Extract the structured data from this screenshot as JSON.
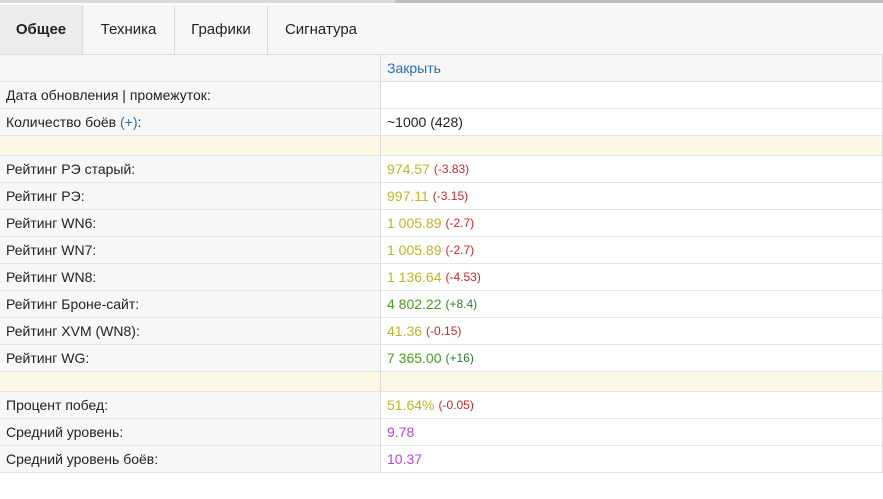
{
  "tabs": [
    {
      "label": "Общее",
      "active": true
    },
    {
      "label": "Техника",
      "active": false
    },
    {
      "label": "Графики",
      "active": false
    },
    {
      "label": "Сигнатура",
      "active": false
    }
  ],
  "header": {
    "close_label": "Закрыть"
  },
  "info": {
    "update_label": "Дата обновления | промежуток:",
    "battles_label": "Количество боёв",
    "battles_plus": "(+)",
    "battles_colon": ":",
    "battles_value": "~1000 (428)"
  },
  "ratings": [
    {
      "label": "Рейтинг РЭ старый:",
      "value": "974.57",
      "delta": "(-3.83)",
      "value_color": "#bfb32b",
      "delta_sign": "neg"
    },
    {
      "label": "Рейтинг РЭ:",
      "value": "997.11",
      "delta": "(-3.15)",
      "value_color": "#bfb32b",
      "delta_sign": "neg"
    },
    {
      "label": "Рейтинг WN6:",
      "value": "1 005.89",
      "delta": "(-2.7)",
      "value_color": "#bfb32b",
      "delta_sign": "neg"
    },
    {
      "label": "Рейтинг WN7:",
      "value": "1 005.89",
      "delta": "(-2.7)",
      "value_color": "#bfb32b",
      "delta_sign": "neg"
    },
    {
      "label": "Рейтинг WN8:",
      "value": "1 136.64",
      "delta": "(-4.53)",
      "value_color": "#bfb32b",
      "delta_sign": "neg"
    },
    {
      "label": "Рейтинг Броне-сайт:",
      "value": "4 802.22",
      "delta": "(+8.4)",
      "value_color": "#4c9a1f",
      "delta_sign": "pos"
    },
    {
      "label": "Рейтинг XVM (WN8):",
      "value": "41.36",
      "delta": "(-0.15)",
      "value_color": "#bfb32b",
      "delta_sign": "neg"
    },
    {
      "label": "Рейтинг WG:",
      "value": "7 365.00",
      "delta": "(+16)",
      "value_color": "#4c9a1f",
      "delta_sign": "pos"
    }
  ],
  "stats": [
    {
      "label": "Процент побед:",
      "value": "51.64%",
      "delta": "(-0.05)",
      "value_color": "#bfb32b"
    },
    {
      "label": "Средний уровень:",
      "value": "9.78",
      "value_color": "#b34ad1"
    },
    {
      "label": "Средний уровень боёв:",
      "value": "10.37",
      "value_color": "#b34ad1"
    }
  ],
  "colors": {
    "link": "#2a6fb0",
    "negative": "#c62828",
    "positive": "#2e7d32",
    "spacer": "#fdf8e6"
  }
}
